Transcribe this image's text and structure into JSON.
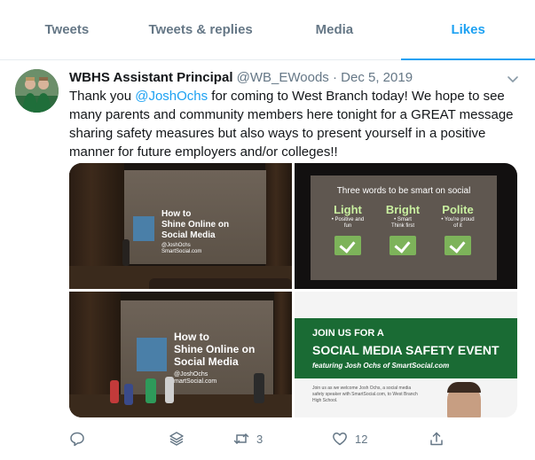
{
  "tabs": [
    {
      "label": "Tweets",
      "active": false
    },
    {
      "label": "Tweets & replies",
      "active": false
    },
    {
      "label": "Media",
      "active": false
    },
    {
      "label": "Likes",
      "active": true
    }
  ],
  "tweet": {
    "author_name": "WBHS Assistant Principal",
    "handle": "@WB_EWoods",
    "separator": "·",
    "date": "Dec 5, 2019",
    "text_before": "Thank you ",
    "mention": "@JoshOchs",
    "text_after": " for coming to West Branch today! We hope to see many parents and community members here tonight for a GREAT message sharing safety measures but also ways to present yourself in a positive manner for future employers and/or colleges!!"
  },
  "media": {
    "photo1": {
      "title": "How to\nShine Online on\nSocial Media",
      "sub": "@JoshOchs\nSmartSocial.com"
    },
    "photo2": {
      "title": "Three words to be smart on social",
      "columns": [
        {
          "word": "Light",
          "desc": "• Positive and\nfun"
        },
        {
          "word": "Bright",
          "desc": "• Smart\nThink first"
        },
        {
          "word": "Polite",
          "desc": "• You're proud\nof it"
        }
      ]
    },
    "photo3": {
      "title": "How to\nShine Online on\nSocial Media",
      "sub": "@JoshOchs\nmartSocial.com"
    },
    "photo4": {
      "line1": "JOIN US FOR A",
      "line2": "SOCIAL MEDIA SAFETY EVENT",
      "line3": "featuring Josh Ochs of SmartSocial.com",
      "body": "Join us as we welcome Josh Ochs, a social media safety speaker with SmartSocial.com, to West Branch High School."
    }
  },
  "actions": {
    "reply_count": "",
    "retweet_count": "3",
    "like_count": "12"
  },
  "icons": [
    "more-caret-icon",
    "reply-icon",
    "thread-stack-icon",
    "retweet-icon",
    "like-heart-icon",
    "share-icon"
  ],
  "colors": {
    "accent": "#1da1f2",
    "muted": "#657786",
    "text": "#14171a",
    "border": "#e6ecf0",
    "flyer_green": "#1a6b34"
  }
}
